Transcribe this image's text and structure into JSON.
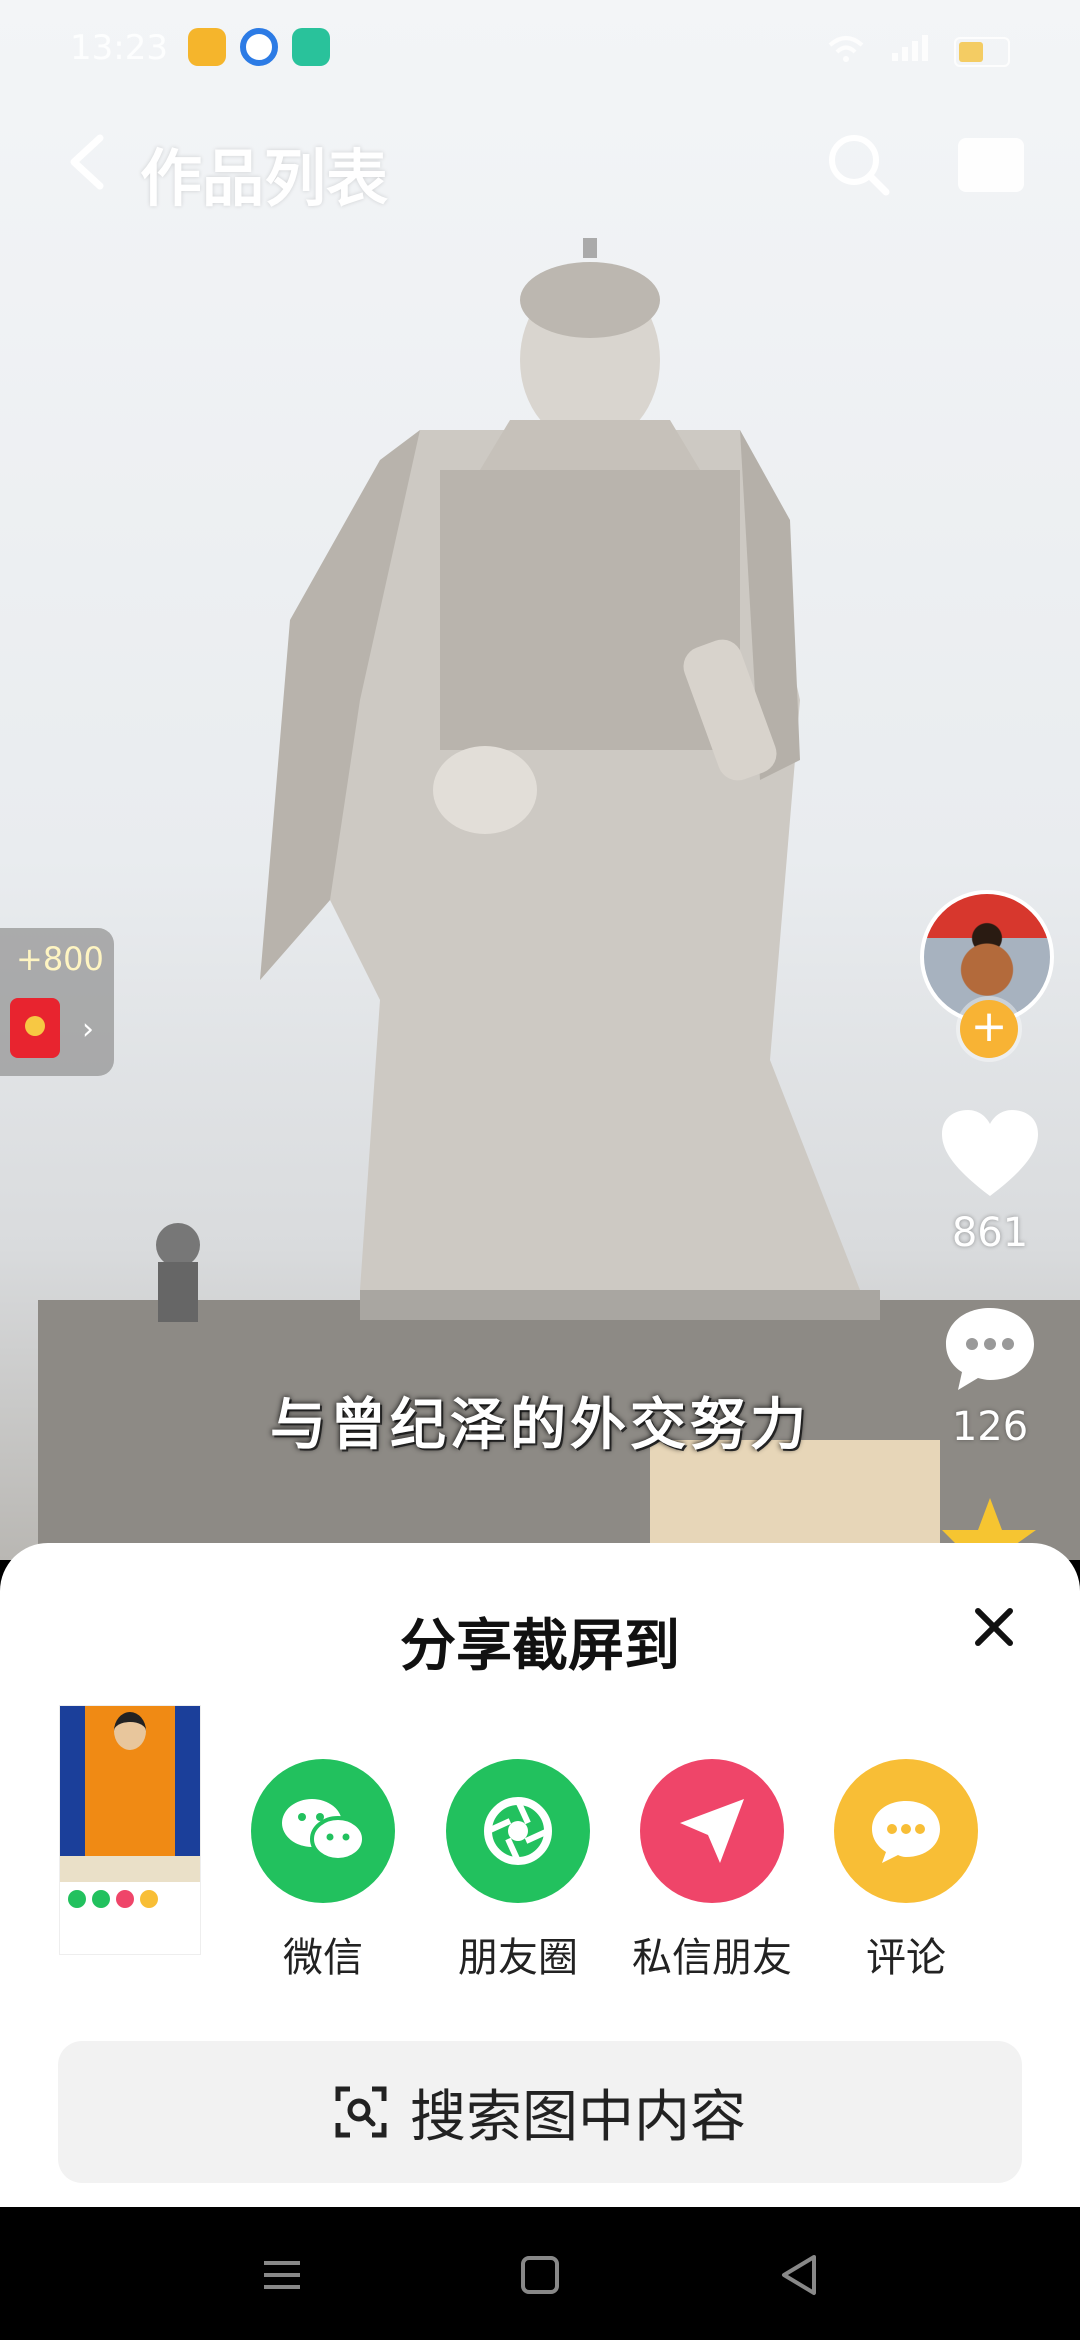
{
  "status_bar": {
    "time": "13:23",
    "apps": [
      {
        "name": "rewards-app-icon",
        "color": "#f5b52c"
      },
      {
        "name": "browser-app-icon",
        "color": "#2c7be5"
      },
      {
        "name": "chat-app-icon",
        "color": "#29c29b"
      }
    ],
    "battery_label": "5"
  },
  "top_bar": {
    "title": "作品列表"
  },
  "video": {
    "subtitle": "与曾纪泽的外交努力"
  },
  "reward": {
    "amount": "+800",
    "arrow": "›"
  },
  "actions": {
    "like_count": "861",
    "comment_count": "126",
    "follow_symbol": "+"
  },
  "share_sheet": {
    "title": "分享截屏到",
    "items": [
      {
        "label": "微信",
        "color": "#22c15e",
        "icon": "wechat-icon"
      },
      {
        "label": "朋友圈",
        "color": "#22c15e",
        "icon": "moments-icon"
      },
      {
        "label": "私信朋友",
        "color": "#ef4569",
        "icon": "send-icon"
      },
      {
        "label": "评论",
        "color": "#f8be36",
        "icon": "comment-icon"
      }
    ],
    "search_label": "搜索图中内容"
  }
}
